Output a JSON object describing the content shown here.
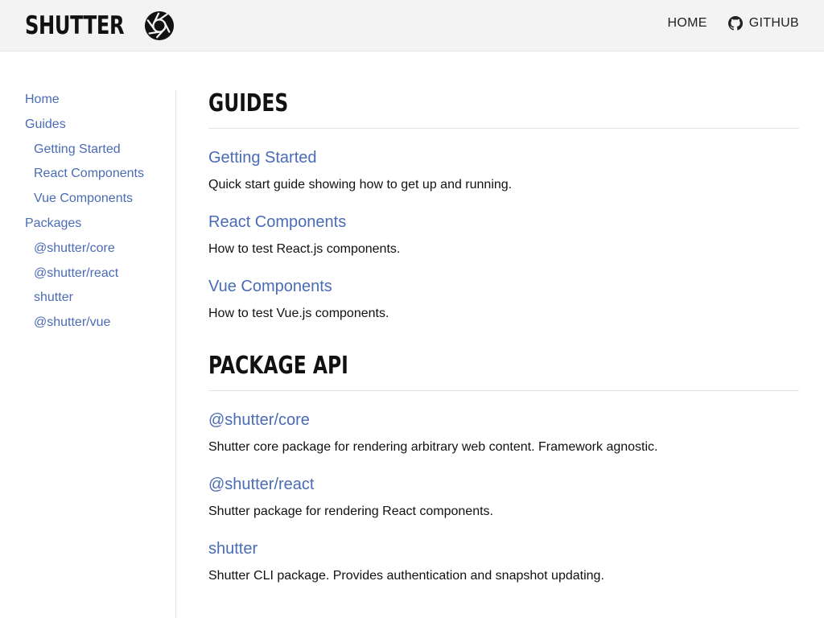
{
  "header": {
    "brand": "SHUTTER",
    "logo_icon": "aperture-icon",
    "nav": [
      {
        "label": "HOME"
      },
      {
        "label": "GITHUB",
        "icon": "github-icon"
      }
    ]
  },
  "sidebar": {
    "items": [
      {
        "label": "Home",
        "level": 0
      },
      {
        "label": "Guides",
        "level": 0
      },
      {
        "label": "Getting Started",
        "level": 1
      },
      {
        "label": "React Components",
        "level": 1
      },
      {
        "label": "Vue Components",
        "level": 1
      },
      {
        "label": "Packages",
        "level": 0
      },
      {
        "label": "@shutter/core",
        "level": 1
      },
      {
        "label": "@shutter/react",
        "level": 1
      },
      {
        "label": "shutter",
        "level": 1
      },
      {
        "label": "@shutter/vue",
        "level": 1
      }
    ]
  },
  "main": {
    "sections": [
      {
        "title": "GUIDES",
        "entries": [
          {
            "title": "Getting Started",
            "description": "Quick start guide showing how to get up and running."
          },
          {
            "title": "React Components",
            "description": "How to test React.js components."
          },
          {
            "title": "Vue Components",
            "description": "How to test Vue.js components."
          }
        ]
      },
      {
        "title": "PACKAGE API",
        "entries": [
          {
            "title": "@shutter/core",
            "description": "Shutter core package for rendering arbitrary web content. Framework agnostic."
          },
          {
            "title": "@shutter/react",
            "description": "Shutter package for rendering React components."
          },
          {
            "title": "shutter",
            "description": "Shutter CLI package. Provides authentication and snapshot updating."
          }
        ]
      }
    ]
  },
  "colors": {
    "link": "#4a6bb5",
    "header_bg": "#f3f3f3",
    "text": "#111111"
  }
}
